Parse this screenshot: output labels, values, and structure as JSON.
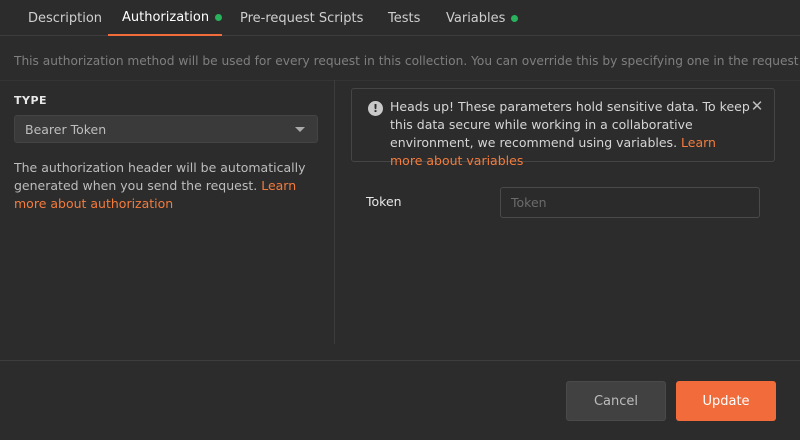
{
  "tabs": [
    {
      "label": "Description",
      "active": false,
      "dot": false
    },
    {
      "label": "Authorization",
      "active": true,
      "dot": true
    },
    {
      "label": "Pre-request Scripts",
      "active": false,
      "dot": true
    },
    {
      "label": "Tests",
      "active": false,
      "dot": false
    },
    {
      "label": "Variables",
      "active": false,
      "dot": true
    }
  ],
  "info_text": "This authorization method will be used for every request in this collection. You can override this by specifying one in the request.",
  "auth": {
    "type_label": "TYPE",
    "selected_type": "Bearer Token",
    "description": "The authorization header will be automatically generated when you send the request. ",
    "learn_more": "Learn more about authorization"
  },
  "alert": {
    "text": "Heads up! These parameters hold sensitive data. To keep this data secure while working in a collaborative environment, we recommend using variables. ",
    "link": "Learn more about variables",
    "icon": "exclamation-icon",
    "close_icon": "close-icon"
  },
  "token": {
    "label": "Token",
    "placeholder": "Token",
    "value": ""
  },
  "buttons": {
    "cancel": "Cancel",
    "update": "Update"
  },
  "colors": {
    "accent": "#f26b3a",
    "dot_green": "#28b25c",
    "link": "#f47b3c"
  }
}
